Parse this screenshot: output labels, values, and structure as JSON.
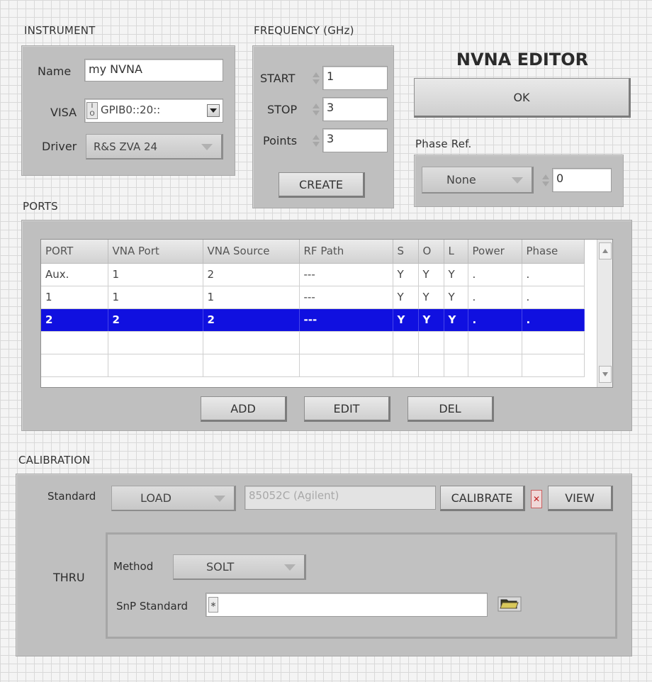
{
  "instrument": {
    "section_label": "INSTRUMENT",
    "name_label": "Name",
    "name_value": "my NVNA",
    "visa_label": "VISA",
    "visa_value": "GPIB0::20::",
    "visa_icon": "io-resource-icon",
    "driver_label": "Driver",
    "driver_value": "R&S ZVA 24"
  },
  "frequency": {
    "section_label": "FREQUENCY (GHz)",
    "start_label": "START",
    "start_value": "1",
    "stop_label": "STOP",
    "stop_value": "3",
    "points_label": "Points",
    "points_value": "3",
    "create_label": "CREATE"
  },
  "editor": {
    "title": "NVNA EDITOR",
    "ok_label": "OK",
    "phase_ref_label": "Phase Ref.",
    "phase_ref_value": "None",
    "phase_ref_number": "0"
  },
  "ports": {
    "section_label": "PORTS",
    "columns": [
      "PORT",
      "VNA Port",
      "VNA Source",
      "RF Path",
      "S",
      "O",
      "L",
      "Power",
      "Phase"
    ],
    "rows": [
      [
        "Aux.",
        "1",
        "2",
        "---",
        "Y",
        "Y",
        "Y",
        ".",
        "."
      ],
      [
        "1",
        "1",
        "1",
        "---",
        "Y",
        "Y",
        "Y",
        ".",
        "."
      ],
      [
        "2",
        "2",
        "2",
        "---",
        "Y",
        "Y",
        "Y",
        ".",
        "."
      ]
    ],
    "selected_row": 2,
    "add_label": "ADD",
    "edit_label": "EDIT",
    "del_label": "DEL"
  },
  "calibration": {
    "section_label": "CALIBRATION",
    "standard_label": "Standard",
    "standard_value": "LOAD",
    "kit_value": "85052C (Agilent)",
    "calibrate_label": "CALIBRATE",
    "view_label": "VIEW",
    "thru_label": "THRU",
    "method_label": "Method",
    "method_value": "SOLT",
    "snp_label": "SnP Standard",
    "snp_value": ""
  },
  "colors": {
    "selected_row": "#1010e0",
    "panel": "#bfbfbf",
    "background": "#f4f4f4"
  }
}
